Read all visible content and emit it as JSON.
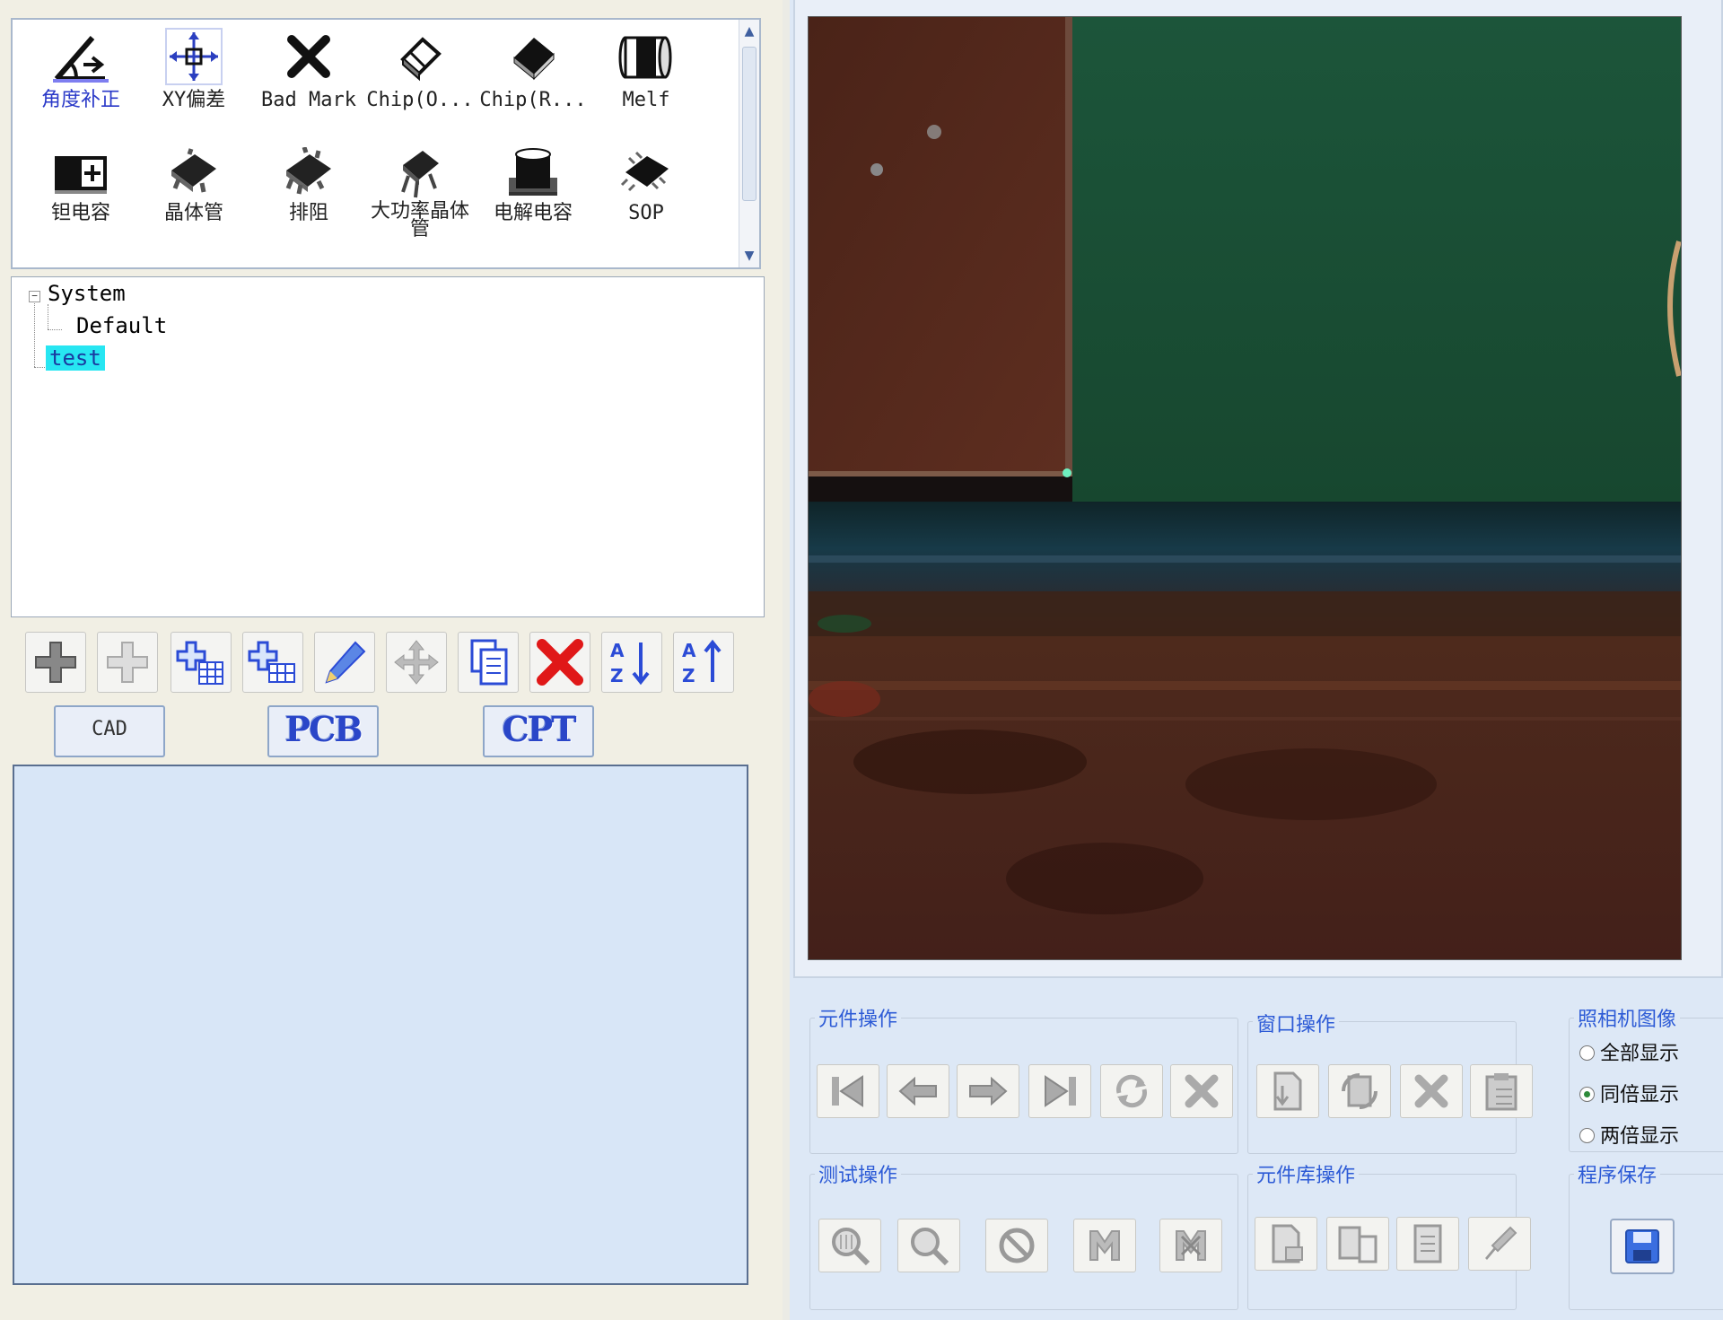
{
  "palette": {
    "items": [
      {
        "label": "角度补正",
        "icon": "angle-correction-icon"
      },
      {
        "label": "XY偏差",
        "icon": "xy-offset-icon"
      },
      {
        "label": "Bad  Mark",
        "icon": "bad-mark-icon"
      },
      {
        "label": "Chip(O...",
        "icon": "chip-icon"
      },
      {
        "label": "Chip(R...",
        "icon": "chip-resistor-icon"
      },
      {
        "label": "Melf",
        "icon": "melf-icon"
      },
      {
        "label": "钽电容",
        "icon": "tantalum-capacitor-icon"
      },
      {
        "label": "晶体管",
        "icon": "transistor-icon"
      },
      {
        "label": "排阻",
        "icon": "resistor-network-icon"
      },
      {
        "label": "大功率晶体管",
        "icon": "power-transistor-icon"
      },
      {
        "label": "电解电容",
        "icon": "electrolytic-capacitor-icon"
      },
      {
        "label": "SOP",
        "icon": "sop-icon"
      }
    ],
    "selected": "角度补正"
  },
  "tree": {
    "root": "System",
    "child": "Default",
    "selected_item": "test"
  },
  "toolbar": {
    "icons": [
      "add-icon",
      "add-disabled-icon",
      "add-table-icon",
      "add-grid-icon",
      "edit-pencil-icon",
      "move-icon",
      "copy-icon",
      "delete-icon",
      "sort-az-icon",
      "sort-za-icon"
    ],
    "cad_label": "CAD",
    "pcb_label": "PCB",
    "cpt_label": "CPT"
  },
  "panels": {
    "component_ops": {
      "title": "元件操作",
      "icons": [
        "first-icon",
        "prev-icon",
        "next-icon",
        "last-icon",
        "refresh-icon",
        "delete-icon"
      ]
    },
    "window_ops": {
      "title": "窗口操作",
      "icons": [
        "window-doc-icon",
        "window-swap-icon",
        "window-close-icon",
        "window-paste-icon"
      ]
    },
    "camera_image": {
      "title": "照相机图像",
      "options": [
        "全部显示",
        "同倍显示",
        "两倍显示"
      ],
      "selected": "同倍显示"
    },
    "test_ops": {
      "title": "测试操作",
      "icons": [
        "zoom-in-icon",
        "zoom-out-icon",
        "stop-icon",
        "mark-icon",
        "mark-cross-icon"
      ]
    },
    "library_ops": {
      "title": "元件库操作",
      "icons": [
        "lib-add-icon",
        "lib-export-icon",
        "lib-doc-icon",
        "lib-tool-icon"
      ]
    },
    "program_save": {
      "title": "程序保存",
      "icon": "save-icon"
    }
  },
  "colors": {
    "accent_blue": "#2d5bd6",
    "tree_selection": "#27e6f2",
    "lower_panel": "#d8e6f7",
    "pcb_green": "#1f5a3a",
    "copper": "#5a2a1c"
  }
}
